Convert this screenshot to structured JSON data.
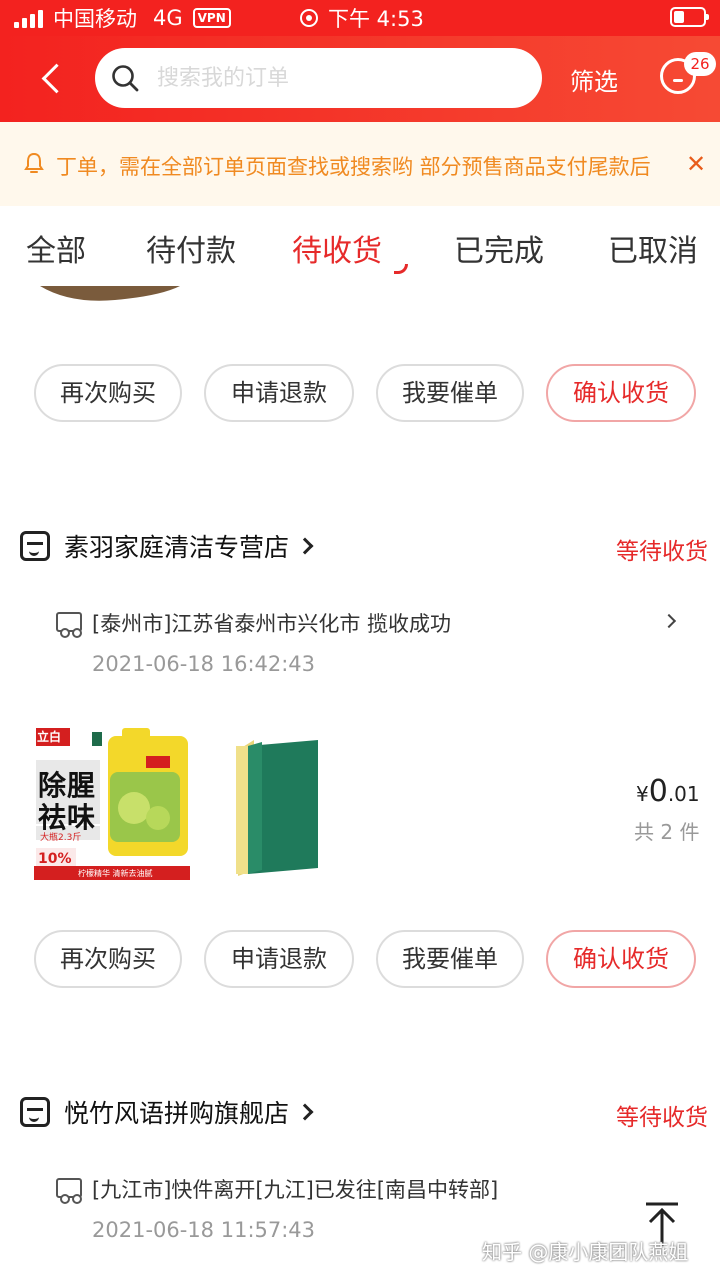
{
  "status_bar": {
    "carrier": "中国移动",
    "network": "4G",
    "vpn": "VPN",
    "time": "下午 4:53"
  },
  "nav": {
    "search_placeholder": "搜索我的订单",
    "filter_label": "筛选",
    "message_badge": "26"
  },
  "notice": {
    "text": "丁单，需在全部订单页面查找或搜索哟  部分预售商品支付尾款后",
    "close": "✕"
  },
  "tabs": [
    {
      "label": "全部"
    },
    {
      "label": "待付款"
    },
    {
      "label": "待收货"
    },
    {
      "label": "已完成"
    },
    {
      "label": "已取消"
    }
  ],
  "order_actions": {
    "rebuy": "再次购买",
    "refund": "申请退款",
    "urge": "我要催单",
    "confirm": "确认收货"
  },
  "orders": [
    {
      "shop": "素羽家庭清洁专营店",
      "status": "等待收货",
      "logistics": "[泰州市]江苏省泰州市兴化市 揽收成功",
      "time": "2021-06-18 16:42:43",
      "price_symbol": "¥",
      "price_int": "0",
      "price_dec": ".01",
      "count": "共 2 件",
      "product_text": {
        "brand": "立白",
        "line1": "除腥",
        "line2": "祛味",
        "size": "大瓶2.3斤",
        "tag": "柠檬精华 清新去油腻",
        "percent": "10%"
      }
    },
    {
      "shop": "悦竹风语拼购旗舰店",
      "status": "等待收货",
      "logistics": "[九江市]快件离开[九江]已发往[南昌中转部]",
      "time": "2021-06-18 11:57:43"
    }
  ],
  "watermark": "知乎 @康小康团队燕姐",
  "colors": {
    "brand_red": "#f3221f",
    "accent_red": "#e62a2a",
    "notice_orange": "#f08a21",
    "notice_bg": "#fff8ec"
  },
  "icons": [
    "back-arrow-icon",
    "search-icon",
    "message-icon",
    "bell-icon",
    "close-icon",
    "shop-icon",
    "chevron-right-icon",
    "truck-icon",
    "back-to-top-icon"
  ]
}
